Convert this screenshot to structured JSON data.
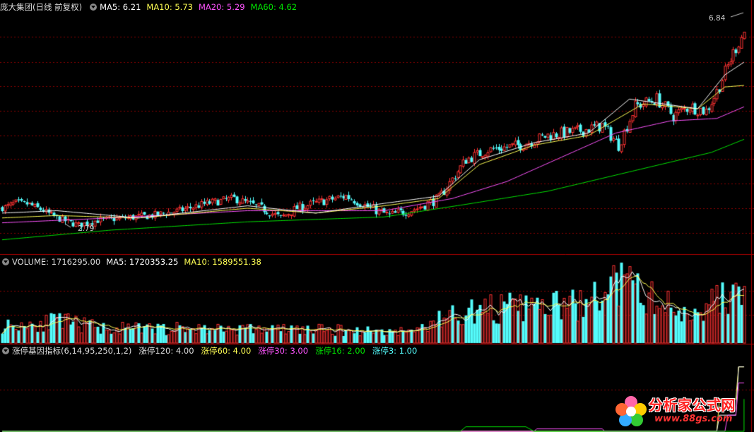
{
  "price_header": {
    "title": "庞大集团(日线 前复权)",
    "ma5": "MA5: 6.21",
    "ma10": "MA10: 5.73",
    "ma20": "MA20: 5.29",
    "ma60": "MA60: 4.62"
  },
  "volume_header": {
    "volume": "VOLUME: 1716295.00",
    "ma5": "MA5: 1720353.25",
    "ma10": "MA10: 1589551.38"
  },
  "indicator_header": {
    "name": "涨停基因指标(6,14,95,250,1,2)",
    "zt120": "涨停120: 4.00",
    "zt60": "涨停60: 4.00",
    "zt30": "涨停30: 3.00",
    "zt16": "涨停16: 2.00",
    "zt3": "涨停3: 1.00"
  },
  "price_labels": {
    "high": "6.84",
    "low": "2.79"
  },
  "watermark": {
    "text": "分析家公式网",
    "url": "www.88gs.com"
  },
  "colors": {
    "up": "#ff3232",
    "down": "#54fcfc",
    "ma5": "#ffffff",
    "ma10": "#ffff54",
    "ma20": "#ff54ff",
    "ma60": "#00e600",
    "grid": "#8b0000",
    "zt120": "#ffff54",
    "zt60": "#ffffff",
    "zt30": "#ff54ff",
    "zt16": "#00e600",
    "zt3": "#54fcfc"
  },
  "chart_data": [
    {
      "type": "candlestick",
      "title": "庞大集团(日线 前复权)",
      "ylim": [
        2.4,
        7.2
      ],
      "high_label": 6.84,
      "low_label": 2.79,
      "price_anchors": [
        [
          0,
          3.2
        ],
        [
          5,
          3.32
        ],
        [
          10,
          3.28
        ],
        [
          15,
          3.15
        ],
        [
          20,
          3.0
        ],
        [
          25,
          2.9
        ],
        [
          28,
          2.85
        ],
        [
          35,
          2.95
        ],
        [
          45,
          3.0
        ],
        [
          55,
          3.05
        ],
        [
          65,
          3.15
        ],
        [
          75,
          3.3
        ],
        [
          85,
          3.4
        ],
        [
          95,
          3.2
        ],
        [
          102,
          3.0
        ],
        [
          108,
          3.2
        ],
        [
          118,
          3.35
        ],
        [
          126,
          3.45
        ],
        [
          135,
          3.2
        ],
        [
          142,
          3.05
        ],
        [
          152,
          3.2
        ],
        [
          160,
          3.4
        ],
        [
          170,
          4.2
        ],
        [
          178,
          4.4
        ],
        [
          190,
          4.5
        ],
        [
          200,
          4.7
        ],
        [
          212,
          4.8
        ],
        [
          220,
          4.9
        ],
        [
          226,
          4.5
        ],
        [
          232,
          5.3
        ],
        [
          240,
          5.45
        ],
        [
          246,
          5.1
        ],
        [
          252,
          5.3
        ],
        [
          258,
          5.2
        ],
        [
          262,
          5.6
        ],
        [
          268,
          6.4
        ],
        [
          272,
          6.84
        ]
      ],
      "ma60_anchors": [
        [
          0,
          2.55
        ],
        [
          40,
          2.75
        ],
        [
          90,
          2.92
        ],
        [
          140,
          3.02
        ],
        [
          170,
          3.28
        ],
        [
          200,
          3.55
        ],
        [
          230,
          3.95
        ],
        [
          260,
          4.35
        ],
        [
          272,
          4.62
        ]
      ],
      "ma20_anchors": [
        [
          0,
          2.9
        ],
        [
          40,
          3.0
        ],
        [
          90,
          3.15
        ],
        [
          140,
          3.15
        ],
        [
          165,
          3.4
        ],
        [
          185,
          3.75
        ],
        [
          205,
          4.25
        ],
        [
          225,
          4.75
        ],
        [
          245,
          5.0
        ],
        [
          262,
          5.05
        ],
        [
          272,
          5.29
        ]
      ],
      "ma10_anchors": [
        [
          0,
          3.0
        ],
        [
          20,
          3.05
        ],
        [
          50,
          3.0
        ],
        [
          90,
          3.2
        ],
        [
          115,
          3.1
        ],
        [
          140,
          3.25
        ],
        [
          160,
          3.4
        ],
        [
          175,
          4.1
        ],
        [
          195,
          4.5
        ],
        [
          215,
          4.7
        ],
        [
          235,
          5.35
        ],
        [
          255,
          5.25
        ],
        [
          265,
          5.7
        ],
        [
          272,
          5.73
        ]
      ],
      "ma5_anchors": [
        [
          0,
          3.1
        ],
        [
          20,
          3.15
        ],
        [
          50,
          3.0
        ],
        [
          90,
          3.25
        ],
        [
          115,
          3.1
        ],
        [
          140,
          3.3
        ],
        [
          160,
          3.45
        ],
        [
          175,
          4.2
        ],
        [
          195,
          4.55
        ],
        [
          215,
          4.75
        ],
        [
          230,
          5.45
        ],
        [
          255,
          5.25
        ],
        [
          265,
          5.95
        ],
        [
          272,
          6.21
        ]
      ]
    },
    {
      "type": "bar",
      "title": "VOLUME",
      "latest": 1716295.0,
      "ma5": 1720353.25,
      "ma10": 1589551.38,
      "ylim": [
        0,
        2600000
      ],
      "volume_anchors": [
        [
          0,
          600000
        ],
        [
          20,
          750000
        ],
        [
          40,
          500000
        ],
        [
          80,
          500000
        ],
        [
          120,
          450000
        ],
        [
          150,
          400000
        ],
        [
          165,
          1000000
        ],
        [
          180,
          1200000
        ],
        [
          200,
          1250000
        ],
        [
          215,
          1350000
        ],
        [
          225,
          2100000
        ],
        [
          235,
          1700000
        ],
        [
          250,
          1000000
        ],
        [
          262,
          1500000
        ],
        [
          272,
          1716295
        ]
      ]
    },
    {
      "type": "line",
      "title": "涨停基因指标(6,14,95,250,1,2)",
      "ylim": [
        0,
        4.6
      ],
      "series": [
        {
          "name": "涨停120",
          "values": [
            [
              0,
              0
            ],
            [
              262,
              0
            ],
            [
              263,
              2
            ],
            [
              269,
              2
            ],
            [
              270,
              4
            ],
            [
              272,
              4
            ]
          ]
        },
        {
          "name": "涨停60",
          "values": [
            [
              0,
              0
            ],
            [
              262,
              0
            ],
            [
              263,
              1
            ],
            [
              269,
              1
            ],
            [
              270,
              4
            ],
            [
              272,
              4
            ]
          ]
        },
        {
          "name": "涨停30",
          "values": [
            [
              0,
              0
            ],
            [
              195,
              0
            ],
            [
              196,
              0.15
            ],
            [
              220,
              0.15
            ],
            [
              221,
              0
            ],
            [
              265,
              0
            ],
            [
              266,
              1
            ],
            [
              269,
              1
            ],
            [
              270,
              3
            ],
            [
              272,
              3
            ]
          ]
        },
        {
          "name": "涨停16",
          "values": [
            [
              0,
              0
            ],
            [
              168,
              0
            ],
            [
              170,
              0.28
            ],
            [
              192,
              0.28
            ],
            [
              195,
              0
            ],
            [
              272,
              0
            ],
            [
              272,
              2
            ]
          ]
        },
        {
          "name": "涨停3",
          "values": [
            [
              0,
              0
            ],
            [
              272,
              1
            ]
          ]
        }
      ]
    }
  ]
}
